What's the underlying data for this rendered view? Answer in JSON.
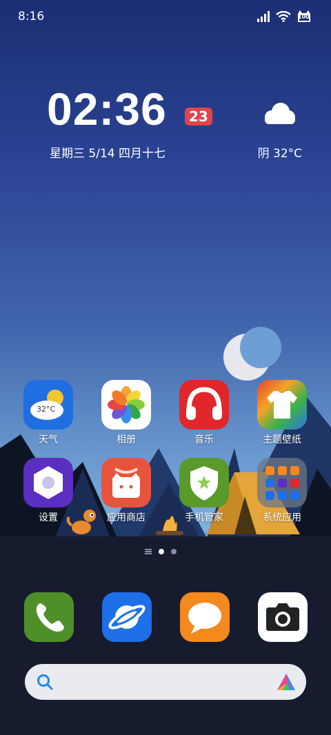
{
  "status_bar": {
    "time": "8:16",
    "battery_level": "100"
  },
  "clock_widget": {
    "time": "02:36",
    "badge": "23",
    "date": "星期三 5/14 四月十七",
    "weather": "阴  32°C",
    "weather_icon": "cloud-icon"
  },
  "apps": [
    {
      "label": "天气",
      "icon": "weather-app-icon",
      "inner_text": "32°C",
      "color": "#1f6fe0"
    },
    {
      "label": "相册",
      "icon": "gallery-app-icon",
      "color": "#ffffff"
    },
    {
      "label": "音乐",
      "icon": "music-app-icon",
      "color": "#e1272b"
    },
    {
      "label": "主题壁纸",
      "icon": "themes-app-icon",
      "color": "#f08a1c"
    },
    {
      "label": "设置",
      "icon": "settings-app-icon",
      "color": "#5b2fc2"
    },
    {
      "label": "应用商店",
      "icon": "app-store-icon",
      "color": "#e8543b"
    },
    {
      "label": "手机管家",
      "icon": "security-app-icon",
      "color": "#5a9a2b"
    },
    {
      "label": "系统应用",
      "icon": "folder-icon",
      "color": "#6b7282"
    }
  ],
  "dock": [
    {
      "icon": "phone-icon",
      "color": "#4f8f2a"
    },
    {
      "icon": "browser-icon",
      "color": "#1e6fe8"
    },
    {
      "icon": "messages-icon",
      "color": "#f48a1e"
    },
    {
      "icon": "camera-icon",
      "color": "#ffffff"
    }
  ],
  "search_bar": {
    "search_icon": "search-icon",
    "assistant_icon": "assistant-icon"
  },
  "colors": {
    "accent_red": "#e3434a",
    "dock_background": "#171b2e"
  }
}
